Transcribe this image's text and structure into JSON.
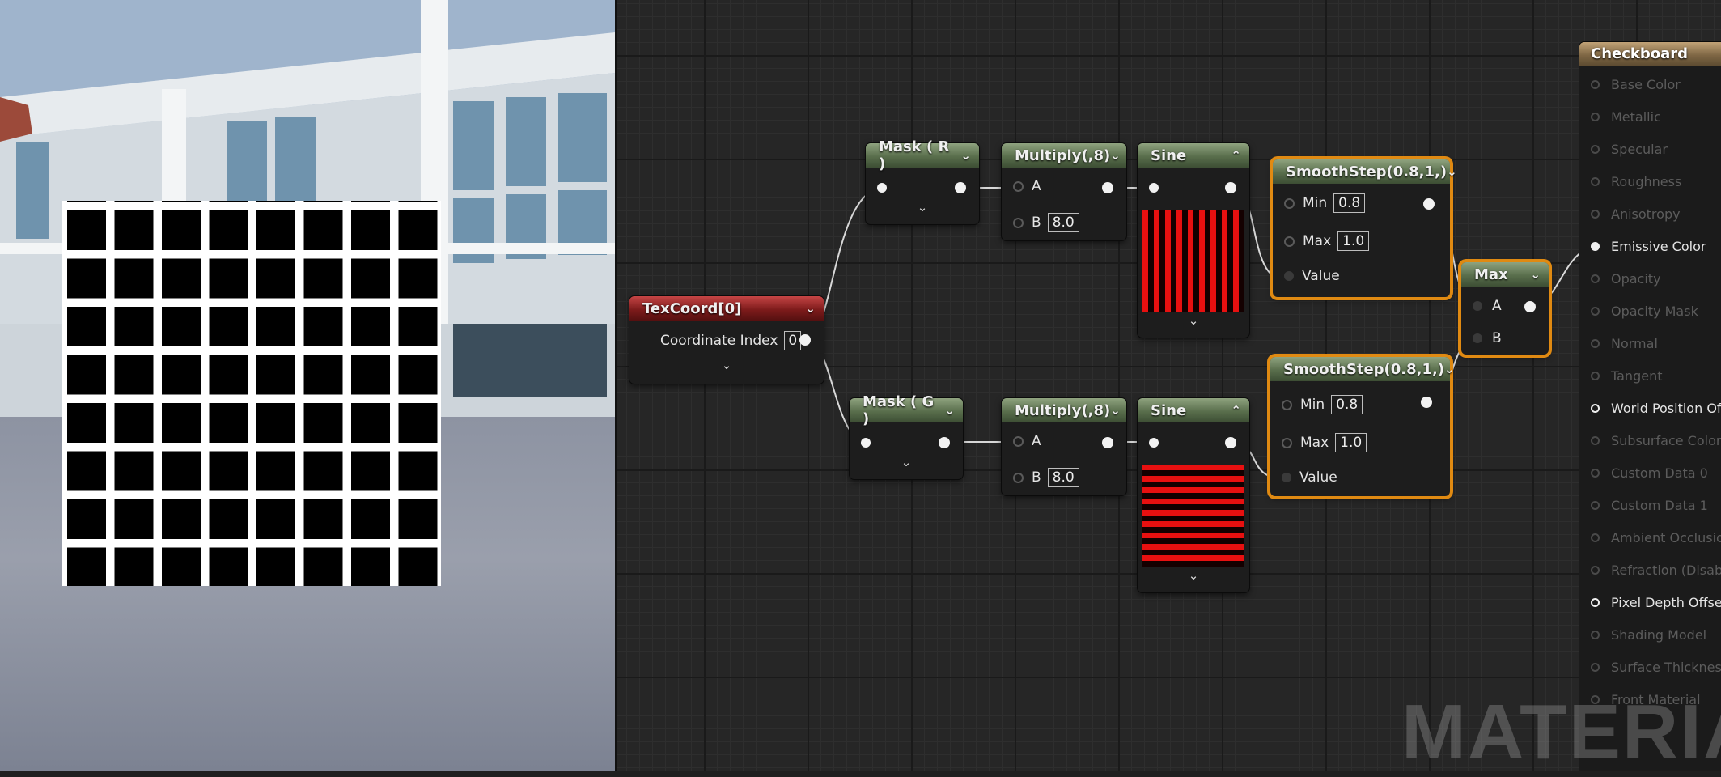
{
  "preview": {
    "description_icon": "checkerboard-preview"
  },
  "nodes": {
    "texcoord": {
      "title": "TexCoord[0]",
      "coord_label": "Coordinate Index",
      "coord_value": "0"
    },
    "mask_r": {
      "title": "Mask ( R )"
    },
    "mask_g": {
      "title": "Mask ( G )"
    },
    "mult_top": {
      "title": "Multiply(,8)",
      "a_label": "A",
      "b_label": "B",
      "b_value": "8.0"
    },
    "mult_bot": {
      "title": "Multiply(,8)",
      "a_label": "A",
      "b_label": "B",
      "b_value": "8.0"
    },
    "sine_top": {
      "title": "Sine"
    },
    "sine_bot": {
      "title": "Sine"
    },
    "smooth_top": {
      "title": "SmoothStep(0.8,1,)",
      "min_label": "Min",
      "min_value": "0.8",
      "max_label": "Max",
      "max_value": "1.0",
      "value_label": "Value"
    },
    "smooth_bot": {
      "title": "SmoothStep(0.8,1,)",
      "min_label": "Min",
      "min_value": "0.8",
      "max_label": "Max",
      "max_value": "1.0",
      "value_label": "Value"
    },
    "max": {
      "title": "Max",
      "a_label": "A",
      "b_label": "B"
    }
  },
  "result": {
    "title": "Checkboard",
    "inputs": [
      {
        "label": "Base Color",
        "state": "off"
      },
      {
        "label": "Metallic",
        "state": "off"
      },
      {
        "label": "Specular",
        "state": "off"
      },
      {
        "label": "Roughness",
        "state": "off"
      },
      {
        "label": "Anisotropy",
        "state": "off"
      },
      {
        "label": "Emissive Color",
        "state": "connected"
      },
      {
        "label": "Opacity",
        "state": "off"
      },
      {
        "label": "Opacity Mask",
        "state": "off"
      },
      {
        "label": "Normal",
        "state": "off"
      },
      {
        "label": "Tangent",
        "state": "off"
      },
      {
        "label": "World Position Offset",
        "state": "on"
      },
      {
        "label": "Subsurface Color",
        "state": "off"
      },
      {
        "label": "Custom Data 0",
        "state": "off"
      },
      {
        "label": "Custom Data 1",
        "state": "off"
      },
      {
        "label": "Ambient Occlusion",
        "state": "off"
      },
      {
        "label": "Refraction (Disabled)",
        "state": "off"
      },
      {
        "label": "Pixel Depth Offset",
        "state": "on"
      },
      {
        "label": "Shading Model",
        "state": "off"
      },
      {
        "label": "Surface Thickness",
        "state": "off"
      },
      {
        "label": "Front Material",
        "state": "off"
      }
    ]
  },
  "watermark": "MATERIAL",
  "colors": {
    "accent_selected": "#e08a12",
    "sine_red": "#e81010",
    "header_green": "#596e4c",
    "header_red": "#7e1b1b"
  }
}
